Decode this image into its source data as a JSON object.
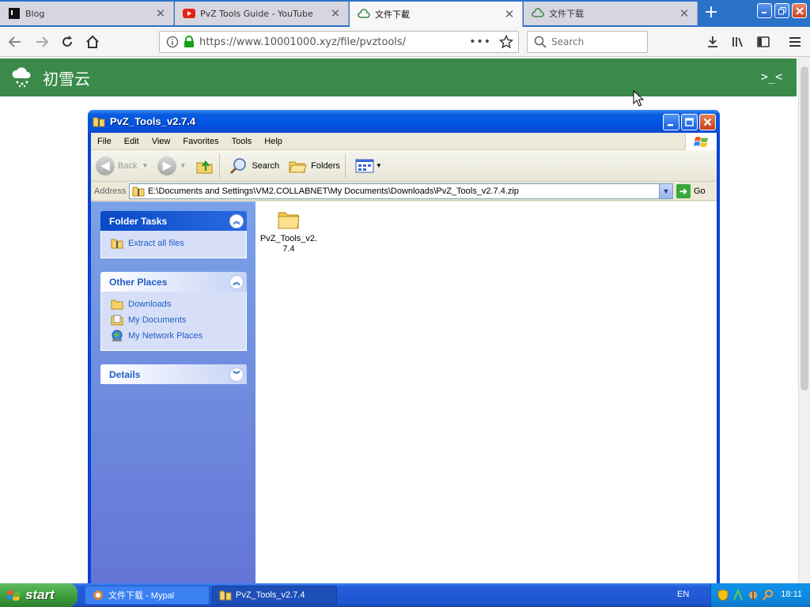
{
  "browser": {
    "tabs": [
      {
        "title": "Blog",
        "active": false
      },
      {
        "title": "PvZ Tools Guide - YouTube",
        "active": false
      },
      {
        "title": "文件下載",
        "active": true
      },
      {
        "title": "文件下载",
        "active": false
      }
    ],
    "url": "https://www.10001000.xyz/file/pvztools/",
    "search_placeholder": "Search"
  },
  "site": {
    "name": "初雪云",
    "toggle": ">_<",
    "header_color": "#3a8a4a"
  },
  "explorer": {
    "title": "PvZ_Tools_v2.7.4",
    "menu": [
      "File",
      "Edit",
      "View",
      "Favorites",
      "Tools",
      "Help"
    ],
    "toolbar": {
      "back": "Back",
      "search": "Search",
      "folders": "Folders"
    },
    "address_label": "Address",
    "address_path": "E:\\Documents and Settings\\VM2.COLLABNET\\My Documents\\Downloads\\PvZ_Tools_v2.7.4.zip",
    "go": "Go",
    "folder_tasks": {
      "title": "Folder Tasks",
      "items": [
        "Extract all files"
      ]
    },
    "other_places": {
      "title": "Other Places",
      "items": [
        "Downloads",
        "My Documents",
        "My Network Places"
      ]
    },
    "details": {
      "title": "Details"
    },
    "files": [
      {
        "name": "PvZ_Tools_v2.7.4"
      }
    ]
  },
  "taskbar": {
    "start": "start",
    "tasks": [
      {
        "label": "文件下载 - Mypal",
        "active": false
      },
      {
        "label": "PvZ_Tools_v2.7.4",
        "active": true
      }
    ],
    "language": "EN",
    "clock": "18:11"
  }
}
